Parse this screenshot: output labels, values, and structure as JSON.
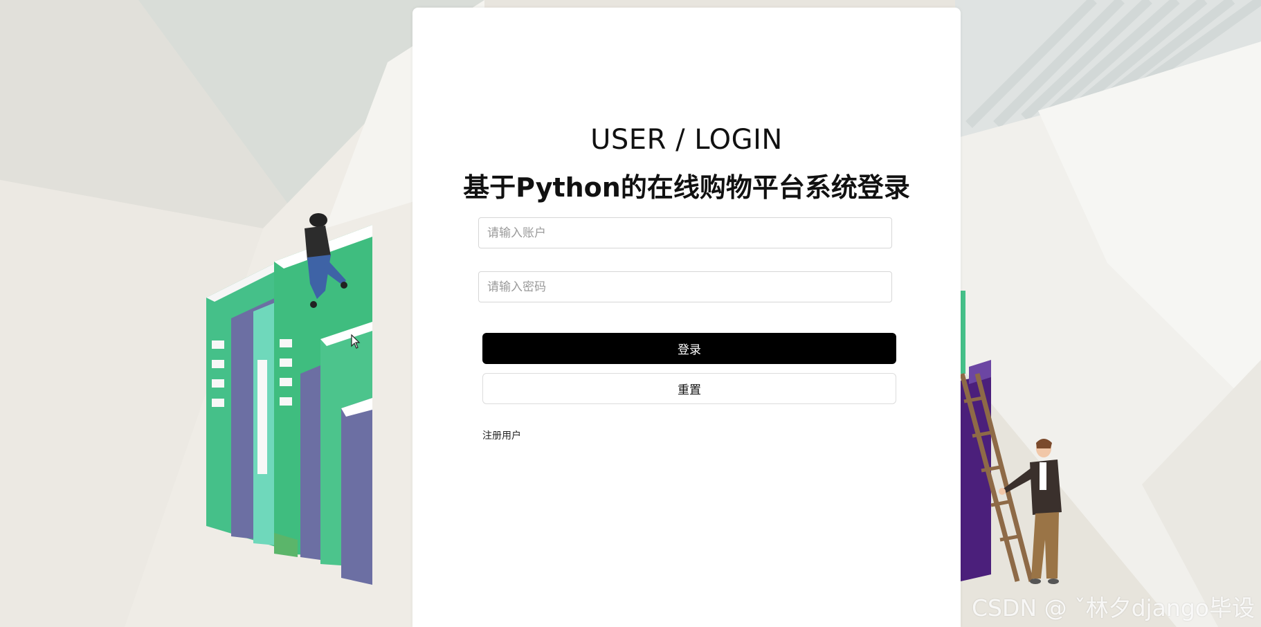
{
  "header": {
    "title_en": "USER / LOGIN",
    "title_cn": "基于Python的在线购物平台系统登录"
  },
  "form": {
    "username": {
      "placeholder": "请输入账户",
      "value": ""
    },
    "password": {
      "placeholder": "请输入密码",
      "value": ""
    },
    "login_label": "登录",
    "reset_label": "重置",
    "register_label": "注册用户"
  },
  "watermark": "CSDN @ ˇ林夕django毕设",
  "colors": {
    "primary_button": "#000000",
    "card_background": "#ffffff",
    "book_green": "#4dc48a",
    "book_purple": "#6c6fa3"
  },
  "icons": [
    "mouse-cursor-icon"
  ]
}
